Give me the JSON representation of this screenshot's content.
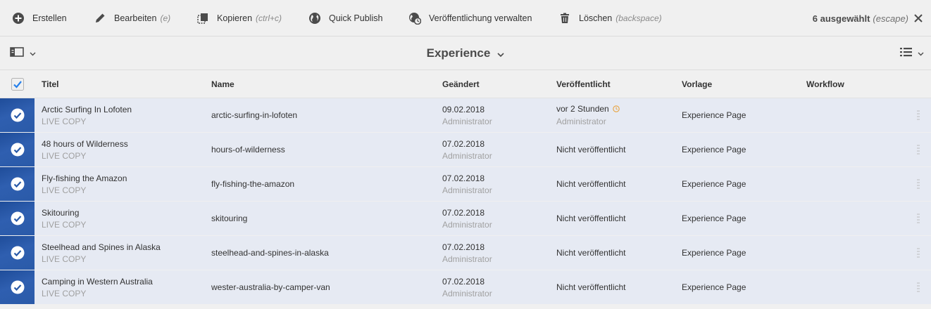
{
  "actionbar": {
    "create": {
      "label": "Erstellen",
      "hint": ""
    },
    "edit": {
      "label": "Bearbeiten",
      "hint": "(e)"
    },
    "copy": {
      "label": "Kopieren",
      "hint": "(ctrl+c)"
    },
    "quick_publish": {
      "label": "Quick Publish",
      "hint": ""
    },
    "manage_publication": {
      "label": "Veröffentlichung verwalten",
      "hint": ""
    },
    "delete": {
      "label": "Löschen",
      "hint": "(backspace)"
    },
    "selection": {
      "count": "6 ausgewählt",
      "hint": "(escape)"
    }
  },
  "titlebar": {
    "title": "Experience"
  },
  "table": {
    "columns": {
      "title": "Titel",
      "name": "Name",
      "modified": "Geändert",
      "published": "Veröffentlicht",
      "template": "Vorlage",
      "workflow": "Workflow"
    },
    "rows": [
      {
        "title": "Arctic Surfing In Lofoten",
        "subtitle": "LIVE COPY",
        "name": "arctic-surfing-in-lofoten",
        "modified_date": "09.02.2018",
        "modified_by": "Administrator",
        "published": "vor 2 Stunden",
        "published_by": "Administrator",
        "template": "Experience Page"
      },
      {
        "title": "48 hours of Wilderness",
        "subtitle": "LIVE COPY",
        "name": "hours-of-wilderness",
        "modified_date": "07.02.2018",
        "modified_by": "Administrator",
        "published": "Nicht veröffentlicht",
        "published_by": "",
        "template": "Experience Page"
      },
      {
        "title": "Fly-fishing the Amazon",
        "subtitle": "LIVE COPY",
        "name": "fly-fishing-the-amazon",
        "modified_date": "07.02.2018",
        "modified_by": "Administrator",
        "published": "Nicht veröffentlicht",
        "published_by": "",
        "template": "Experience Page"
      },
      {
        "title": "Skitouring",
        "subtitle": "LIVE COPY",
        "name": "skitouring",
        "modified_date": "07.02.2018",
        "modified_by": "Administrator",
        "published": "Nicht veröffentlicht",
        "published_by": "",
        "template": "Experience Page"
      },
      {
        "title": "Steelhead and Spines in Alaska",
        "subtitle": "LIVE COPY",
        "name": "steelhead-and-spines-in-alaska",
        "modified_date": "07.02.2018",
        "modified_by": "Administrator",
        "published": "Nicht veröffentlicht",
        "published_by": "",
        "template": "Experience Page"
      },
      {
        "title": "Camping in Western Australia",
        "subtitle": "LIVE COPY",
        "name": "wester-australia-by-camper-van",
        "modified_date": "07.02.2018",
        "modified_by": "Administrator",
        "published": "Nicht veröffentlicht",
        "published_by": "",
        "template": "Experience Page"
      }
    ]
  },
  "colors": {
    "selected_row": "#e6eaf3",
    "thumb_blue": "#2a5aa8",
    "accent": "#2680eb",
    "pending_clock": "#e8a33d"
  }
}
